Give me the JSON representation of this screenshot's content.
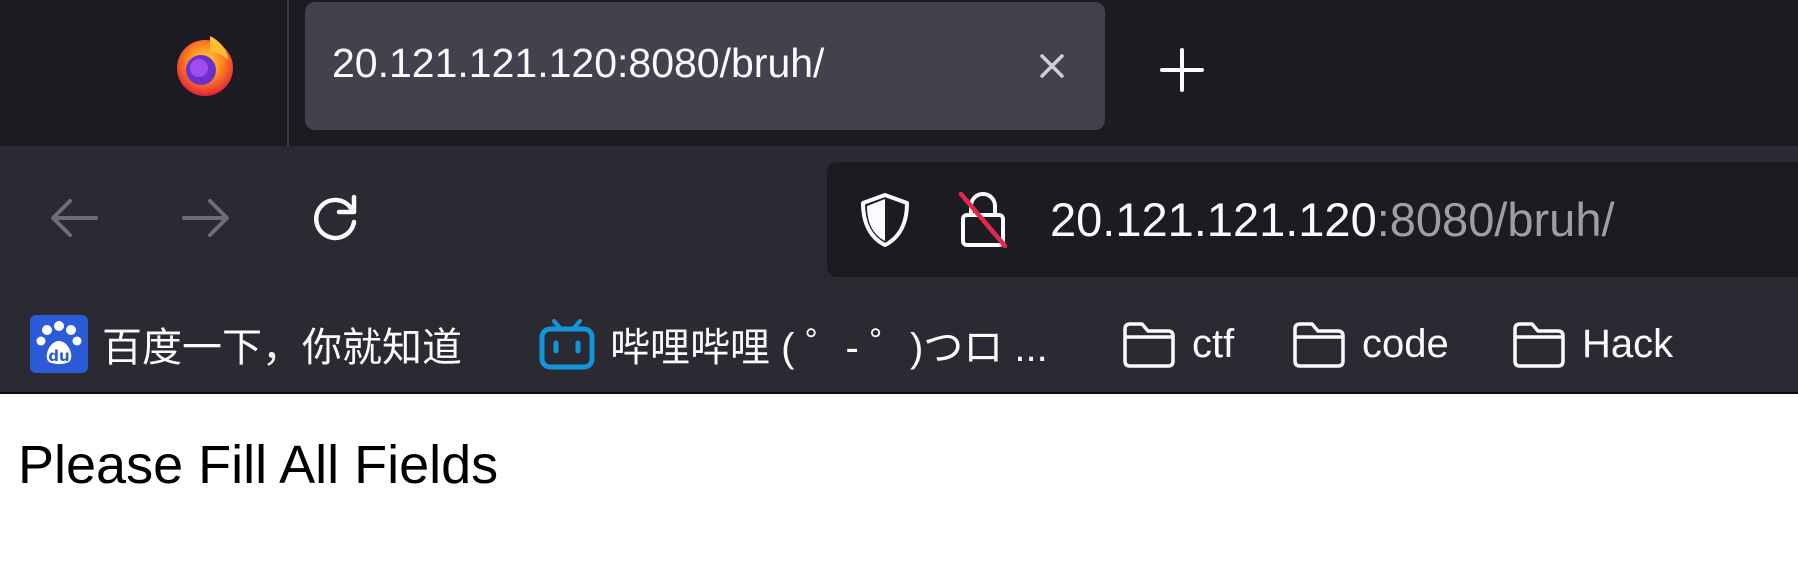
{
  "browser": {
    "tab": {
      "title": "20.121.121.120:8080/bruh/"
    },
    "urlbar": {
      "host": "20.121.121.120",
      "path": ":8080/bruh/"
    },
    "icons": {
      "app": "firefox-logo-icon",
      "tab_close": "close-icon",
      "new_tab": "plus-icon",
      "back": "arrow-left-icon",
      "forward": "arrow-right-icon",
      "reload": "reload-icon",
      "tracking": "shield-icon",
      "security": "insecure-lock-icon"
    },
    "bookmarks": [
      {
        "label": "百度一下，你就知道",
        "icon": "baidu-paw-icon"
      },
      {
        "label": "哔哩哔哩 ( ゜- ゜)つロ ...",
        "icon": "bilibili-tv-icon"
      },
      {
        "label": "ctf",
        "icon": "folder-icon"
      },
      {
        "label": "code",
        "icon": "folder-icon"
      },
      {
        "label": "Hack",
        "icon": "folder-icon"
      }
    ],
    "colors": {
      "tabstrip_bg": "#1c1b22",
      "active_tab_bg": "#42414d",
      "toolbar_bg": "#2b2a33",
      "insecure_strike": "#e22850",
      "bilibili_blue": "#1296db",
      "baidu_blue": "#2b5bd7"
    }
  },
  "page": {
    "message": "Please Fill All Fields"
  }
}
